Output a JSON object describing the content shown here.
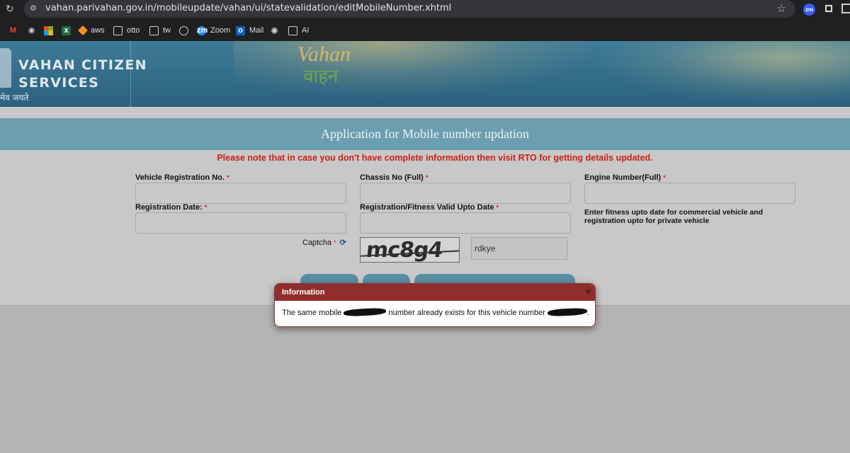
{
  "browser": {
    "url": "vahan.parivahan.gov.in/mobileupdate/vahan/ui/statevalidation/editMobileNumber.xhtml",
    "bookmarks": [
      {
        "label": "",
        "icon": "gmail-icon"
      },
      {
        "label": "",
        "icon": "globe-icon"
      },
      {
        "label": "",
        "icon": "microsoft-icon"
      },
      {
        "label": "",
        "icon": "excel-icon"
      },
      {
        "label": "aws",
        "icon": "aws-icon"
      },
      {
        "label": "otto",
        "icon": "folder-icon"
      },
      {
        "label": "tw",
        "icon": "folder-icon"
      },
      {
        "label": "",
        "icon": "github-icon"
      },
      {
        "label": "Zoom",
        "icon": "zoom-icon"
      },
      {
        "label": "Mail",
        "icon": "outlook-icon"
      },
      {
        "label": "",
        "icon": "chatgpt-icon"
      },
      {
        "label": "AI",
        "icon": "folder-icon"
      }
    ]
  },
  "header": {
    "logo_line1": "VAHAN CITIZEN",
    "logo_line2": "SERVICES",
    "emblem_text": "मेव जयते",
    "brand_en": "Vahan",
    "brand_hi": "वाहन"
  },
  "page": {
    "title": "Application for Mobile number updation",
    "notice": "Please note that in case you don't have complete information then visit RTO for getting details updated."
  },
  "form": {
    "required_marker": "*",
    "vehicle_reg_label": "Vehicle Registration No.",
    "chassis_label": "Chassis No (Full)",
    "engine_label": "Engine Number(Full)",
    "reg_date_label": "Registration Date:",
    "fitness_label": "Registration/Fitness Valid Upto Date",
    "fitness_hint": "Enter fitness upto date for commercial vehicle and registration upto for private vehicle",
    "captcha_label": "Captcha",
    "captcha_image_text": "mc8g4",
    "captcha_input_value": "rdkye"
  },
  "dialog": {
    "title": "Information",
    "close": "×",
    "msg_part1": "The same mobile ",
    "msg_part2": " number already exists for this vehicle number ",
    "msg_part3": "."
  }
}
